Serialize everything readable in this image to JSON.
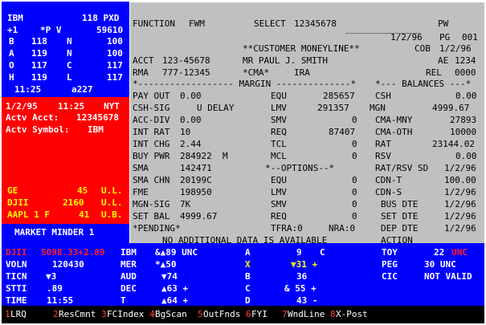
{
  "quote": {
    "symbol": "IBM",
    "price": "118 PXD",
    "change": "+1",
    "flags": "*P V",
    "volume": "59610",
    "rows": [
      {
        "l": "B",
        "v1": "118",
        "m": "N",
        "v2": "100"
      },
      {
        "l": "A",
        "v1": "119",
        "m": "N",
        "v2": "100"
      },
      {
        "l": "O",
        "v1": "117",
        "m": "C",
        "v2": "117"
      },
      {
        "l": "H",
        "v1": "119",
        "m": "L",
        "v2": "117"
      }
    ],
    "time": "11:25",
    "code": "a227"
  },
  "account": {
    "date": "1/2/95",
    "time": "11:25",
    "exch": "NYT",
    "actv_acct_label": "Actv Acct:",
    "actv_acct": "12345678",
    "actv_symbol_label": "Actv Symbol:",
    "actv_symbol": "IBM"
  },
  "minder": {
    "rows": [
      {
        "sym": "GE",
        "val": "45",
        "unit": "U.L."
      },
      {
        "sym": "DJII",
        "val": "2160",
        "unit": "U.L."
      },
      {
        "sym": "AAPL 1 F",
        "val": "41",
        "unit": "U.B."
      }
    ],
    "title": "MARKET MINDER 1"
  },
  "main": {
    "function_label": "FUNCTION",
    "function_value": "FWM",
    "select_label": "SELECT",
    "select_value": "12345678",
    "select_suffix": "PW",
    "date": "1/2/96",
    "page_label": "PG",
    "page": "001",
    "header_title": "**CUSTOMER MONEYLINE**",
    "cob_label": "COB",
    "cob": "1/2/96",
    "acct_label": "ACCT",
    "acct": "123-45678",
    "name": "MR PAUL J. SMITH",
    "ae_label": "AE",
    "ae": "1234",
    "rma_label": "RMA",
    "rma": "777-12345",
    "cma": "*CMA*",
    "ira": "IRA",
    "rel_label": "REL",
    "rel": "0000",
    "margin_divider": "*------------------ MARGIN --------------*",
    "balances_divider": "*--- BALANCES ---*",
    "left_rows": [
      {
        "label": "PAY OUT",
        "value": "0.00"
      },
      {
        "label": "CSH-SIG",
        "value": "U DELAY"
      },
      {
        "label": "ACC-DIV",
        "value": "0.00"
      },
      {
        "label": "INT RAT",
        "value": "10"
      },
      {
        "label": "INT CHG",
        "value": "2.44"
      },
      {
        "label": "BUY PWR",
        "value": "284922  M"
      },
      {
        "label": "SMA",
        "value": "142471"
      },
      {
        "label": "SMA CHN",
        "value": "20199C"
      },
      {
        "label": "FME",
        "value": "198950"
      },
      {
        "label": "MGN-SIG",
        "value": "7K"
      },
      {
        "label": "SET BAL",
        "value": "4999.67"
      },
      {
        "label": "*PENDING*",
        "value": ""
      }
    ],
    "mid_rows": [
      {
        "label": "EQU",
        "value": "285657"
      },
      {
        "label": "LMV",
        "value": "291357"
      },
      {
        "label": "SMV",
        "value": "0"
      },
      {
        "label": "REQ",
        "value": "87407"
      },
      {
        "label": "TCL",
        "value": "0"
      },
      {
        "label": "MCL",
        "value": "0"
      },
      {
        "label": "*--OPTIONS--*",
        "value": ""
      },
      {
        "label": "EQU",
        "value": "0"
      },
      {
        "label": "LMV",
        "value": "0"
      },
      {
        "label": "SMV",
        "value": "0"
      },
      {
        "label": "REQ",
        "value": "0"
      },
      {
        "label": "TFRA:0",
        "value": "NRA:0"
      }
    ],
    "right_rows": [
      {
        "label": "CSH",
        "value": "0.00"
      },
      {
        "label": "MGN",
        "value": "4999.67"
      },
      {
        "label": "CMA-MNY",
        "value": "27893"
      },
      {
        "label": "CMA-OTH",
        "value": "10000"
      },
      {
        "label": "RAT",
        "value": "23144.02"
      },
      {
        "label": "RSV",
        "value": "0.00"
      },
      {
        "label": "RAT/RSV SD",
        "value": "1/2/96"
      },
      {
        "label": "CDN-T",
        "value": "100.00"
      },
      {
        "label": "CDN-S",
        "value": "1/2/96"
      },
      {
        "label": "BUS DTE",
        "value": "1/2/96"
      },
      {
        "label": "SET DTE",
        "value": "1/2/96"
      },
      {
        "label": "DEP DTE",
        "value": "1/2/96"
      }
    ],
    "message": "NO ADDITIONAL DATA IS AVAILABLE",
    "action_label": "ACTION"
  },
  "bottom": {
    "col1": [
      {
        "label": "DJII",
        "value": "5098.33+2.89"
      },
      {
        "label": "VOLN",
        "value": "120430"
      },
      {
        "label": "TICN",
        "value": "▼3"
      },
      {
        "label": "STTI",
        "value": ".89"
      },
      {
        "label": "TIME",
        "value": "11:55"
      }
    ],
    "col2": [
      {
        "label": "IBM",
        "value": "&▲89 UNC"
      },
      {
        "label": "MER",
        "value": "*▲50"
      },
      {
        "label": "AUD",
        "value": "▼74"
      },
      {
        "label": "DEC",
        "value": "▲63 +"
      },
      {
        "label": "T",
        "value": "▲64 +"
      }
    ],
    "col3": [
      {
        "label": "A",
        "value": "9",
        "extra": "C"
      },
      {
        "label": "X",
        "value": "▼31 +",
        "extra": ""
      },
      {
        "label": "B",
        "value": "36",
        "extra": ""
      },
      {
        "label": "C",
        "value": "& 55 +",
        "extra": ""
      },
      {
        "label": "D",
        "value": "43 -",
        "extra": ""
      }
    ],
    "col4": [
      {
        "label": "TOY",
        "value": "22",
        "extra": "UNC"
      },
      {
        "label": "PEG",
        "value": "30 UNC",
        "extra": ""
      },
      {
        "label": "CIC",
        "value": "NOT VALID",
        "extra": ""
      }
    ]
  },
  "fkeys": [
    {
      "num": "1",
      "label": "LRQ"
    },
    {
      "num": "2",
      "label": "ResCmnt"
    },
    {
      "num": "3",
      "label": "FCIndex"
    },
    {
      "num": "4",
      "label": "BgScan"
    },
    {
      "num": "5",
      "label": "OutFnds"
    },
    {
      "num": "6",
      "label": "FYI"
    },
    {
      "num": "7",
      "label": "WndLine"
    },
    {
      "num": "8",
      "label": "X-Post"
    }
  ],
  "colors": {
    "blue": "#0000ff",
    "red": "#ff0000",
    "gray": "#c0c0c0",
    "yellow": "#ffff00"
  }
}
